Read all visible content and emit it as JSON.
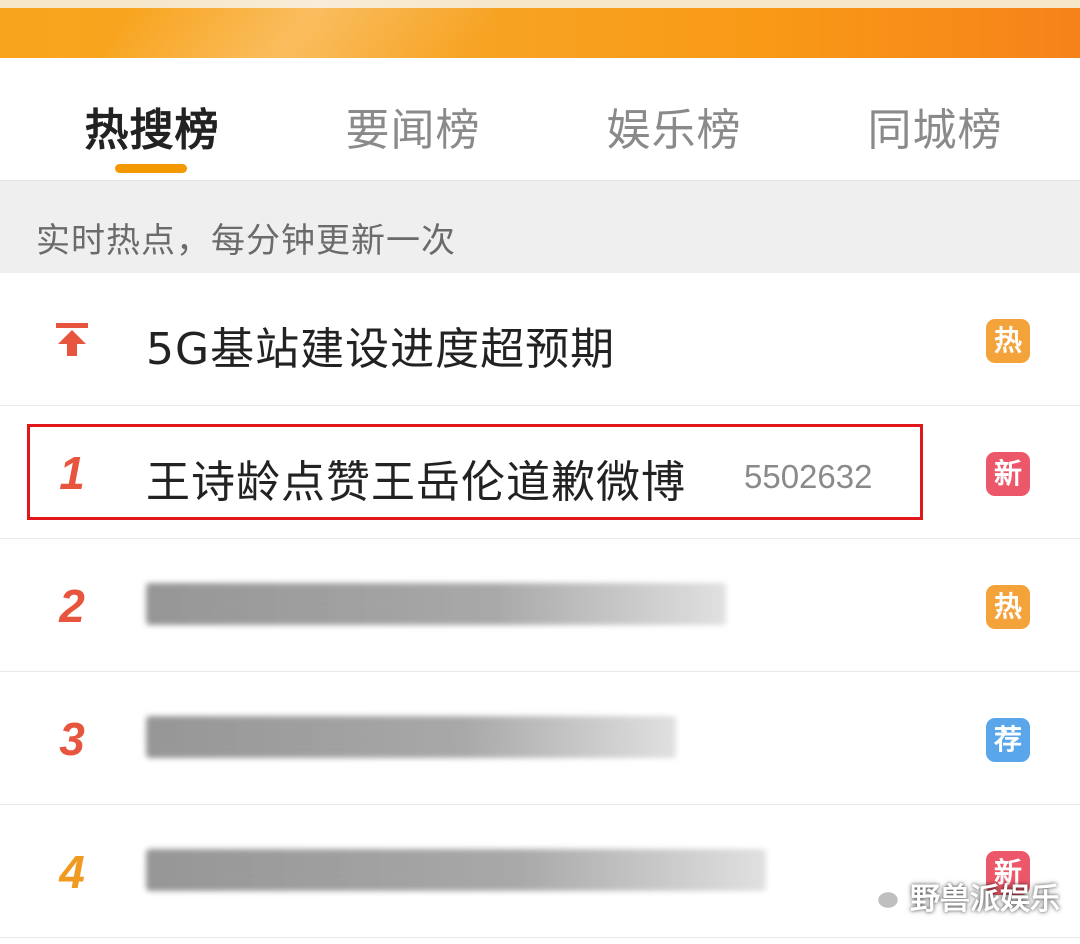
{
  "tabs": [
    {
      "label": "热搜榜",
      "active": true
    },
    {
      "label": "要闻榜",
      "active": false
    },
    {
      "label": "娱乐榜",
      "active": false
    },
    {
      "label": "同城榜",
      "active": false
    }
  ],
  "subheader": {
    "text": "实时热点，每分钟更新一次"
  },
  "rows": [
    {
      "rank": "",
      "rank_icon": "pinned-arrow-up-icon",
      "title": "5G基站建设进度超预期",
      "count": "",
      "badge": "热",
      "badge_color": "#f3a33a"
    },
    {
      "rank": "1",
      "title": "王诗龄点赞王岳伦道歉微博",
      "count": "5502632",
      "badge": "新",
      "badge_color": "#ec5869"
    },
    {
      "rank": "2",
      "title": "",
      "count": "",
      "badge": "热",
      "badge_color": "#f3a33a"
    },
    {
      "rank": "3",
      "title": "",
      "count": "",
      "badge": "荐",
      "badge_color": "#5aa6ea"
    },
    {
      "rank": "4",
      "title": "",
      "count": "",
      "badge": "新",
      "badge_color": "#ec5869"
    }
  ],
  "watermark": {
    "text": "野兽派娱乐",
    "icon": "wechat-icon"
  },
  "colors": {
    "accent": "#f39800",
    "rank_red": "#e8553e",
    "rank_orange": "#f09a22",
    "highlight_box": "#e0161b"
  }
}
